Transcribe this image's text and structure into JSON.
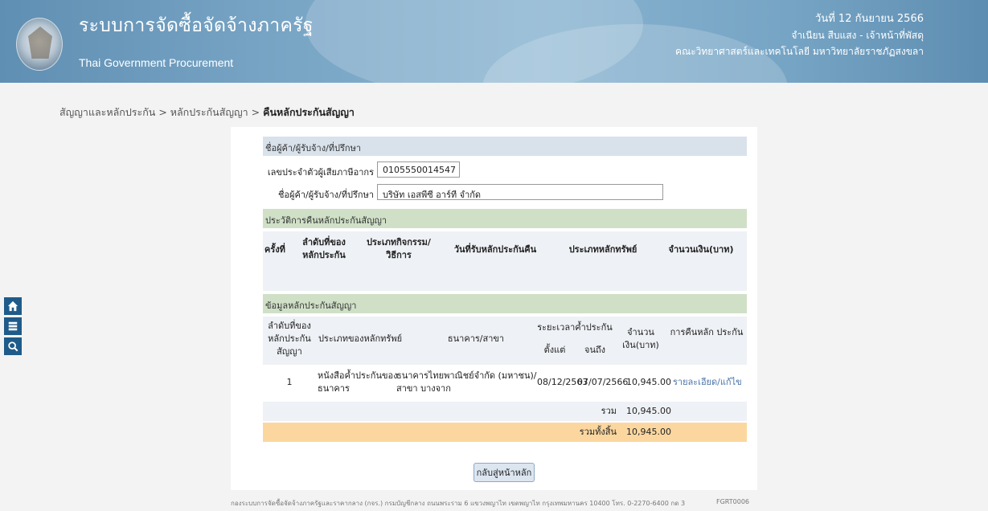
{
  "header": {
    "title_th": "ระบบการจัดซื้อจัดจ้างภาครัฐ",
    "title_en": "Thai Government Procurement",
    "date": "วันที่ 12 กันยายน 2566",
    "user": "จำเนียน สืบแสง - เจ้าหน้าที่พัสดุ",
    "org": "คณะวิทยาศาสตร์และเทคโนโลยี มหาวิทยาลัยราชภัฏสงขลา"
  },
  "side": {
    "home": "home-icon",
    "menu": "menu-icon",
    "search": "search-icon"
  },
  "breadcrumb": {
    "item1": "สัญญาและหลักประกัน",
    "sep": ">",
    "item2": "หลักประกันสัญญา",
    "current": "คืนหลักประกันสัญญา"
  },
  "vendor": {
    "section_title": "ชื่อผู้ค้า/ผู้รับจ้าง/ที่ปรึกษา",
    "tax_label": "เลขประจำตัวผู้เสียภาษีอากร",
    "tax_value": "0105550014547",
    "name_label": "ชื่อผู้ค้า/ผู้รับจ้าง/ที่ปรึกษา",
    "name_value": "บริษัท เอสพีซี อาร์ที จำกัด"
  },
  "history": {
    "section_title": "ประวัติการคืนหลักประกันสัญญา",
    "columns": [
      "ครั้งที่",
      "ลำดับที่ของ หลักประกัน",
      "ประเภทกิจกรรม/ วิธีการ",
      "วันที่รับหลักประกันคืน",
      "ประเภทหลักทรัพย์",
      "จำนวนเงิน(บาท)"
    ]
  },
  "contract": {
    "section_title": "ข้อมูลหลักประกันสัญญา",
    "col_seq": "ลำดับที่ของ หลักประกัน สัญญา",
    "col_type": "ประเภทของหลักทรัพย์",
    "col_bank": "ธนาคาร/สาขา",
    "col_period": "ระยะเวลาค้ำประกัน",
    "col_from": "ตั้งแต่",
    "col_to": "จนถึง",
    "col_amount": "จำนวน เงิน(บาท)",
    "col_return": "การคืนหลัก ประกัน",
    "row": {
      "seq": "1",
      "type": "หนังสือค้ำประกันของ ธนาคาร",
      "bank": "ธนาคารไทยพาณิชย์จำกัด (มหาชน)/สาขา บางจาก",
      "from": "08/12/2563",
      "to": "07/07/2566",
      "amount": "10,945.00",
      "action": "รายละเอียด/แก้ไข"
    },
    "sum_label": "รวม",
    "sum_value": "10,945.00",
    "total_label": "รวมทั้งสิ้น",
    "total_value": "10,945.00"
  },
  "back_button": "กลับสู่หน้าหลัก",
  "footer": {
    "text": "กองระบบการจัดซื้อจัดจ้างภาครัฐและราคากลาง (กจร.) กรมบัญชีกลาง ถนนพระราม 6 แขวงพญาไท เขตพญาไท กรุงเทพมหานคร 10400 โทร. 0-2270-6400 กด 3",
    "code": "FGRT0006"
  }
}
